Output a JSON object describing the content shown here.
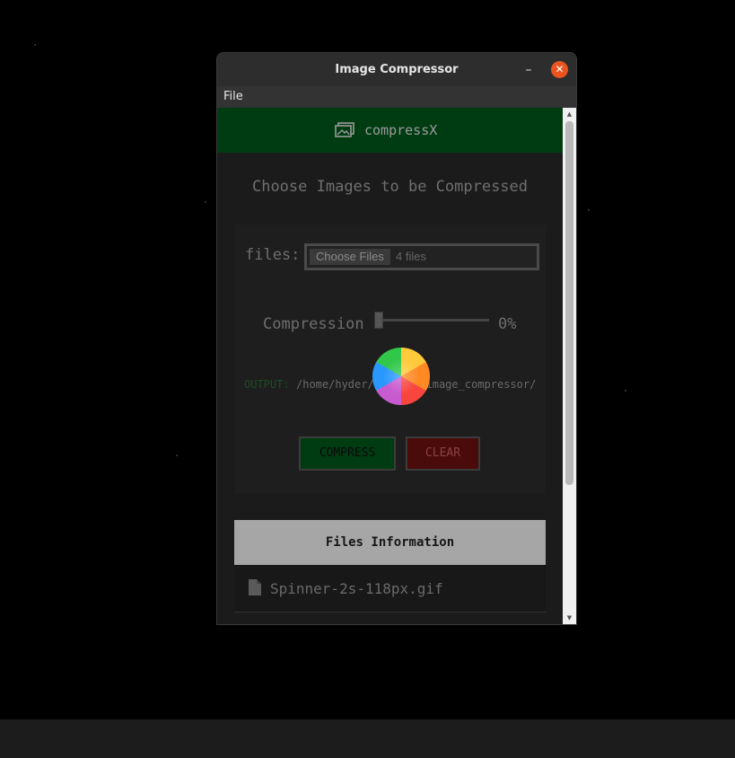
{
  "window": {
    "title": "Image Compressor",
    "minimize_icon": "minimize-icon",
    "close_icon": "close-icon"
  },
  "menu": {
    "file": "File"
  },
  "app": {
    "brand": "compressX",
    "heading": "Choose Images to be Compressed",
    "files_label": "files:",
    "choose_button": "Choose Files",
    "file_count": "4 files",
    "compression_label": "Compression",
    "compression_value": "0%",
    "compression_level": 0,
    "output_label": "OUTPUT:",
    "output_path": "/home/hyder/Desktop/image_compressor/",
    "compress_button": "COMPRESS",
    "clear_button": "CLEAR",
    "files_info_title": "Files Information",
    "files": [
      {
        "name": "Spinner-2s-118px.gif"
      }
    ]
  },
  "colors": {
    "header_green": "#003c12",
    "clear_red": "#4a0b0b",
    "close_orange": "#e9541f"
  }
}
